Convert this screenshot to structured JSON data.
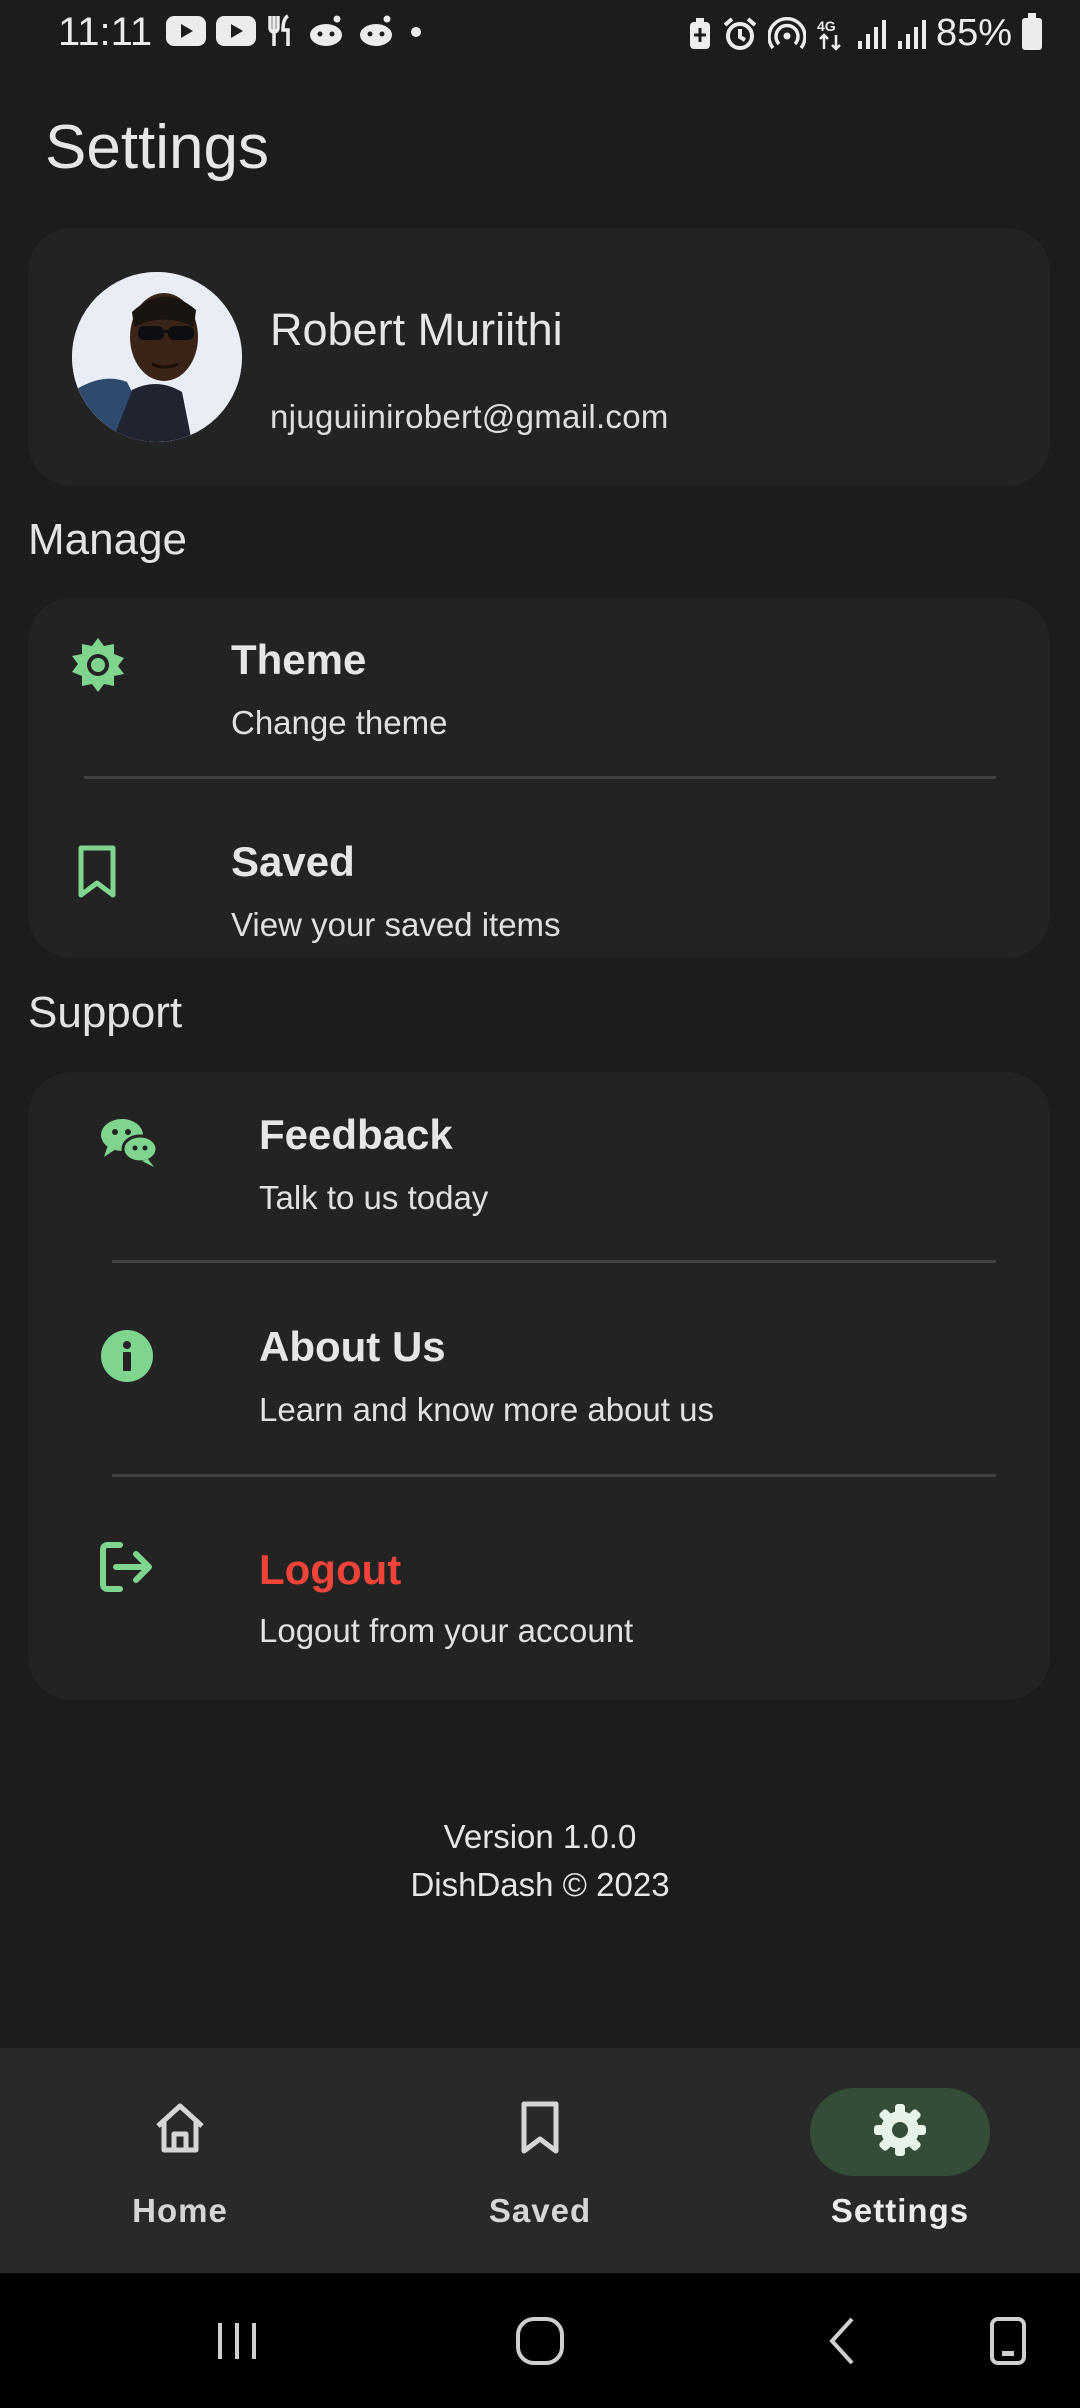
{
  "status_bar": {
    "time": "11:11",
    "battery_percent": "85%",
    "left_icons": [
      "youtube-icon",
      "youtube-icon",
      "restaurant-icon",
      "reddit-icon",
      "reddit-icon",
      "dot-icon"
    ],
    "right_icons": [
      "battery-saver-icon",
      "alarm-icon",
      "hotspot-icon",
      "4g-icon",
      "signal-icon",
      "signal-icon",
      "battery-icon"
    ]
  },
  "page": {
    "title": "Settings"
  },
  "profile": {
    "name": "Robert Muriithi",
    "email": "njuguiinirobert@gmail.com"
  },
  "manage": {
    "label": "Manage",
    "items": [
      {
        "title": "Theme",
        "subtitle": "Change theme",
        "icon": "sun-icon"
      },
      {
        "title": "Saved",
        "subtitle": "View your saved items",
        "icon": "bookmark-icon"
      }
    ]
  },
  "support": {
    "label": "Support",
    "items": [
      {
        "title": "Feedback",
        "subtitle": "Talk to us today",
        "icon": "chat-icon"
      },
      {
        "title": "About Us",
        "subtitle": "Learn and know more about us",
        "icon": "info-icon"
      },
      {
        "title": "Logout",
        "subtitle": "Logout from your account",
        "icon": "logout-icon"
      }
    ]
  },
  "footer": {
    "version": "Version 1.0.0",
    "copyright": "DishDash © 2023"
  },
  "bottom_nav": {
    "items": [
      {
        "label": "Home",
        "icon": "home-icon",
        "active": false
      },
      {
        "label": "Saved",
        "icon": "bookmark-icon",
        "active": false
      },
      {
        "label": "Settings",
        "icon": "gear-icon",
        "active": true
      }
    ]
  },
  "colors": {
    "background": "#1b1c1c",
    "card": "#232323",
    "accent_green": "#7fd58d",
    "logout_red": "#f0443a",
    "nav_active_pill": "#344c38"
  }
}
